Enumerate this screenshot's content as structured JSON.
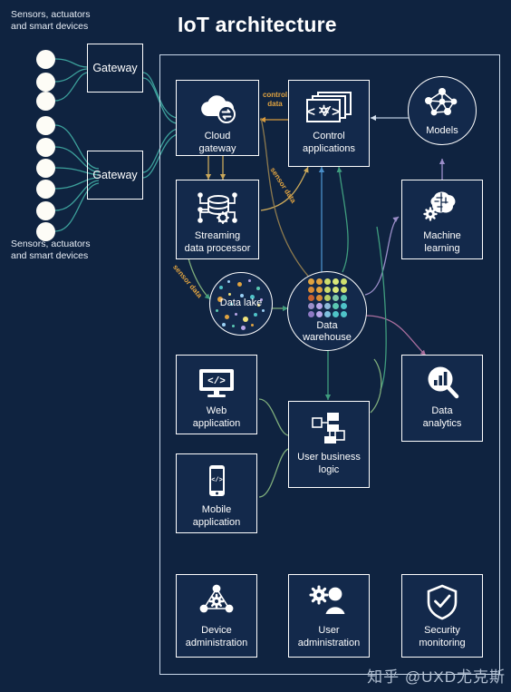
{
  "page": {
    "title": "IoT architecture",
    "background_color": "#0f2340",
    "panel_border_color": "#c9d8ea",
    "watermark": "知乎 @UXD尤克斯"
  },
  "left_column": {
    "sensor_label_top": "Sensors, actuators\nand smart devices",
    "sensor_label_bottom": "Sensors, actuators\nand smart devices",
    "sensor_count_top_group": 3,
    "sensor_count_bottom_group": 6,
    "gateways": [
      {
        "label": "Gateway",
        "name": "gateway-top"
      },
      {
        "label": "Gateway",
        "name": "gateway-bottom"
      }
    ]
  },
  "nodes": {
    "cloud_gateway": {
      "label": "Cloud\ngateway",
      "icon": "cloud-sync-icon"
    },
    "control_applications": {
      "label": "Control\napplications",
      "icon": "code-gear-windows-icon"
    },
    "models": {
      "label": "Models",
      "icon": "network-graph-icon"
    },
    "streaming_data_processor": {
      "label": "Streaming\ndata processor",
      "icon": "database-gear-icon"
    },
    "machine_learning": {
      "label": "Machine\nlearning",
      "icon": "brain-gear-icon"
    },
    "data_lake": {
      "label": "Data lake",
      "icon": "scattered-dots-icon"
    },
    "data_warehouse": {
      "label": "Data\nwarehouse",
      "icon": "dot-matrix-icon"
    },
    "web_application": {
      "label": "Web\napplication",
      "icon": "monitor-code-icon"
    },
    "mobile_application": {
      "label": "Mobile\napplication",
      "icon": "phone-code-icon"
    },
    "user_business_logic": {
      "label": "User business\nlogic",
      "icon": "flowchart-icon"
    },
    "data_analytics": {
      "label": "Data\nanalytics",
      "icon": "chart-magnifier-icon"
    },
    "device_administration": {
      "label": "Device\nadministration",
      "icon": "device-gear-icon"
    },
    "user_administration": {
      "label": "User\nadministration",
      "icon": "user-gear-icon"
    },
    "security_monitoring": {
      "label": "Security\nmonitoring",
      "icon": "shield-check-icon"
    }
  },
  "flow_labels": {
    "control_data": "control\ndata",
    "sensor_data_upper": "sensor data",
    "sensor_data_lower": "sensor data"
  },
  "colors": {
    "sensor_wire": "#3fa7a0",
    "flow_label": "#e0a340",
    "control_data_arrow": "#d89a3c",
    "sensor_data_arrow": "#caa85a",
    "blue_line": "#4a8fc9",
    "green_line": "#3f9d7e",
    "purple_line": "#9b8ec9",
    "magenta_line": "#a96f9e",
    "node_fill": "#13294b",
    "sensor_dot": "#fdfcf6"
  },
  "chart_data": {
    "type": "diagram",
    "title": "IoT architecture",
    "nodes": [
      "Sensors, actuators and smart devices",
      "Gateway",
      "Gateway",
      "Cloud gateway",
      "Control applications",
      "Models",
      "Streaming data processor",
      "Machine learning",
      "Data lake",
      "Data warehouse",
      "Web application",
      "Mobile application",
      "User business logic",
      "Data analytics",
      "Device administration",
      "User administration",
      "Security monitoring"
    ],
    "edges": [
      {
        "from": "Sensors, actuators and smart devices",
        "to": "Gateway",
        "label": ""
      },
      {
        "from": "Gateway",
        "to": "Cloud gateway",
        "label": ""
      },
      {
        "from": "Control applications",
        "to": "Cloud gateway",
        "label": "control data"
      },
      {
        "from": "Cloud gateway",
        "to": "Streaming data processor",
        "label": ""
      },
      {
        "from": "Streaming data processor",
        "to": "Control applications",
        "label": "sensor data"
      },
      {
        "from": "Streaming data processor",
        "to": "Data lake",
        "label": "sensor data"
      },
      {
        "from": "Streaming data processor",
        "to": "Data warehouse",
        "label": ""
      },
      {
        "from": "Data lake",
        "to": "Data warehouse",
        "label": ""
      },
      {
        "from": "Models",
        "to": "Control applications",
        "label": ""
      },
      {
        "from": "Machine learning",
        "to": "Models",
        "label": ""
      },
      {
        "from": "Data warehouse",
        "to": "Machine learning",
        "label": ""
      },
      {
        "from": "Data warehouse",
        "to": "User business logic",
        "label": ""
      },
      {
        "from": "Data warehouse",
        "to": "Data analytics",
        "label": ""
      },
      {
        "from": "Data warehouse",
        "to": "Control applications",
        "label": ""
      },
      {
        "from": "Web application",
        "to": "User business logic",
        "label": ""
      },
      {
        "from": "Mobile application",
        "to": "User business logic",
        "label": ""
      }
    ]
  }
}
